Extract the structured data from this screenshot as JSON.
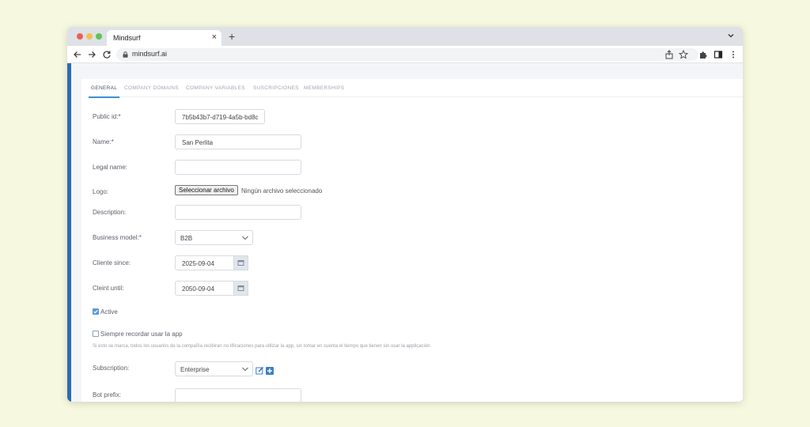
{
  "browser": {
    "tab_title": "Mindsurf",
    "url": "mindsurf.ai"
  },
  "nav_tabs": [
    {
      "label": "GENERAL"
    },
    {
      "label": "COMPANY DOMAINS"
    },
    {
      "label": "COMPANY VARIABLES"
    },
    {
      "label": "SUSCRIPCIONES"
    },
    {
      "label": "MEMBERSHIPS"
    }
  ],
  "form": {
    "public_id": {
      "label": "Public id:*",
      "value": "7b5b43b7-d719-4a5b-bd8c"
    },
    "name": {
      "label": "Name:*",
      "value": "San Perlita"
    },
    "legal_name": {
      "label": "Legal name:",
      "value": ""
    },
    "logo": {
      "label": "Logo:",
      "button": "Seleccionar archivo",
      "status": "Ningún archivo seleccionado"
    },
    "description": {
      "label": "Description:",
      "value": ""
    },
    "business_model": {
      "label": "Business model:*",
      "value": "B2B"
    },
    "cliente_since": {
      "label": "Cliente since:",
      "value": "2025-09-04"
    },
    "cleint_until": {
      "label": "Cleint until:",
      "value": "2050-09-04"
    },
    "active": {
      "label": "Active",
      "checked": true
    },
    "siempre": {
      "label": "Siempre recordar usar la app",
      "checked": false,
      "help": "Si esto se marca, todos los usuarios de la compañía recibiran no tificaciones para utilizar la app, sin tomar en cuenta el tiempo que tienen sin usar la applicación."
    },
    "subscription": {
      "label": "Subscription:",
      "value": "Enterprise"
    },
    "bot_prefix": {
      "label": "Bot prefix:",
      "value": ""
    }
  },
  "colors": {
    "accent": "#3d8fd1",
    "sidebar": "#2b6cb0",
    "background": "#f6f8df"
  }
}
